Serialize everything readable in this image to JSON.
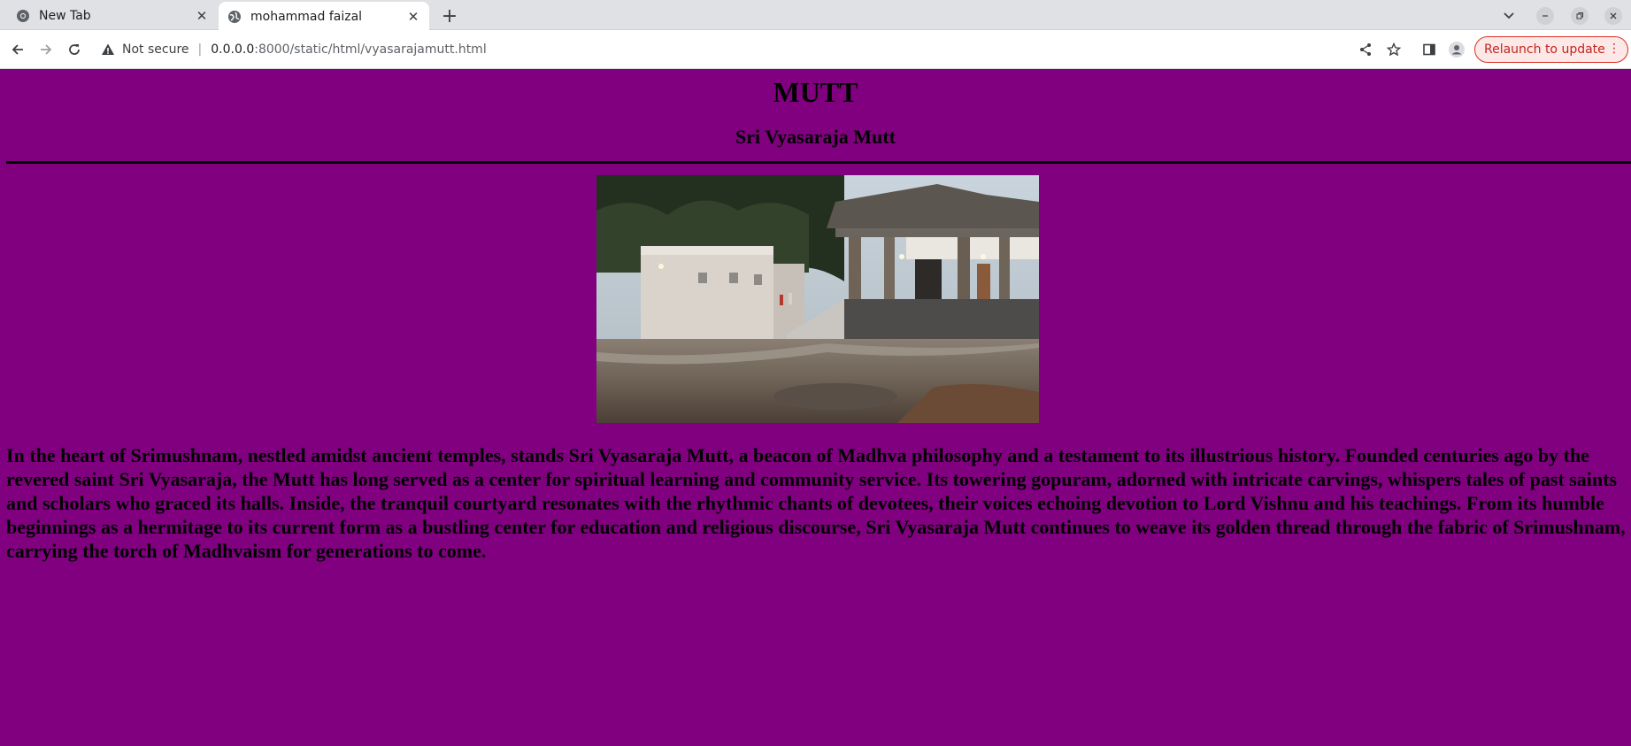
{
  "browser": {
    "tabs": [
      {
        "label": "New Tab",
        "active": false
      },
      {
        "label": "mohammad faizal",
        "active": true
      }
    ],
    "address": {
      "security_label": "Not secure",
      "host": "0.0.0.0",
      "path": ":8000/static/html/vyasarajamutt.html"
    },
    "relaunch_label": "Relaunch to update",
    "colors": {
      "relaunch": "#c5221f"
    }
  },
  "page": {
    "background": "#800080",
    "heading": "MUTT",
    "subheading": "Sri Vyasaraja Mutt",
    "paragraph": "In the heart of Srimushnam, nestled amidst ancient temples, stands Sri Vyasaraja Mutt, a beacon of Madhva philosophy and a testament to its illustrious history. Founded centuries ago by the revered saint Sri Vyasaraja, the Mutt has long served as a center for spiritual learning and community service. Its towering gopuram, adorned with intricate carvings, whispers tales of past saints and scholars who graced its halls. Inside, the tranquil courtyard resonates with the rhythmic chants of devotees, their voices echoing devotion to Lord Vishnu and his teachings. From its humble beginnings as a hermitage to its current form as a bustling center for education and religious discourse, Sri Vyasaraja Mutt continues to weave its golden thread through the fabric of Srimushnam, carrying the torch of Madhvaism for generations to come."
  }
}
